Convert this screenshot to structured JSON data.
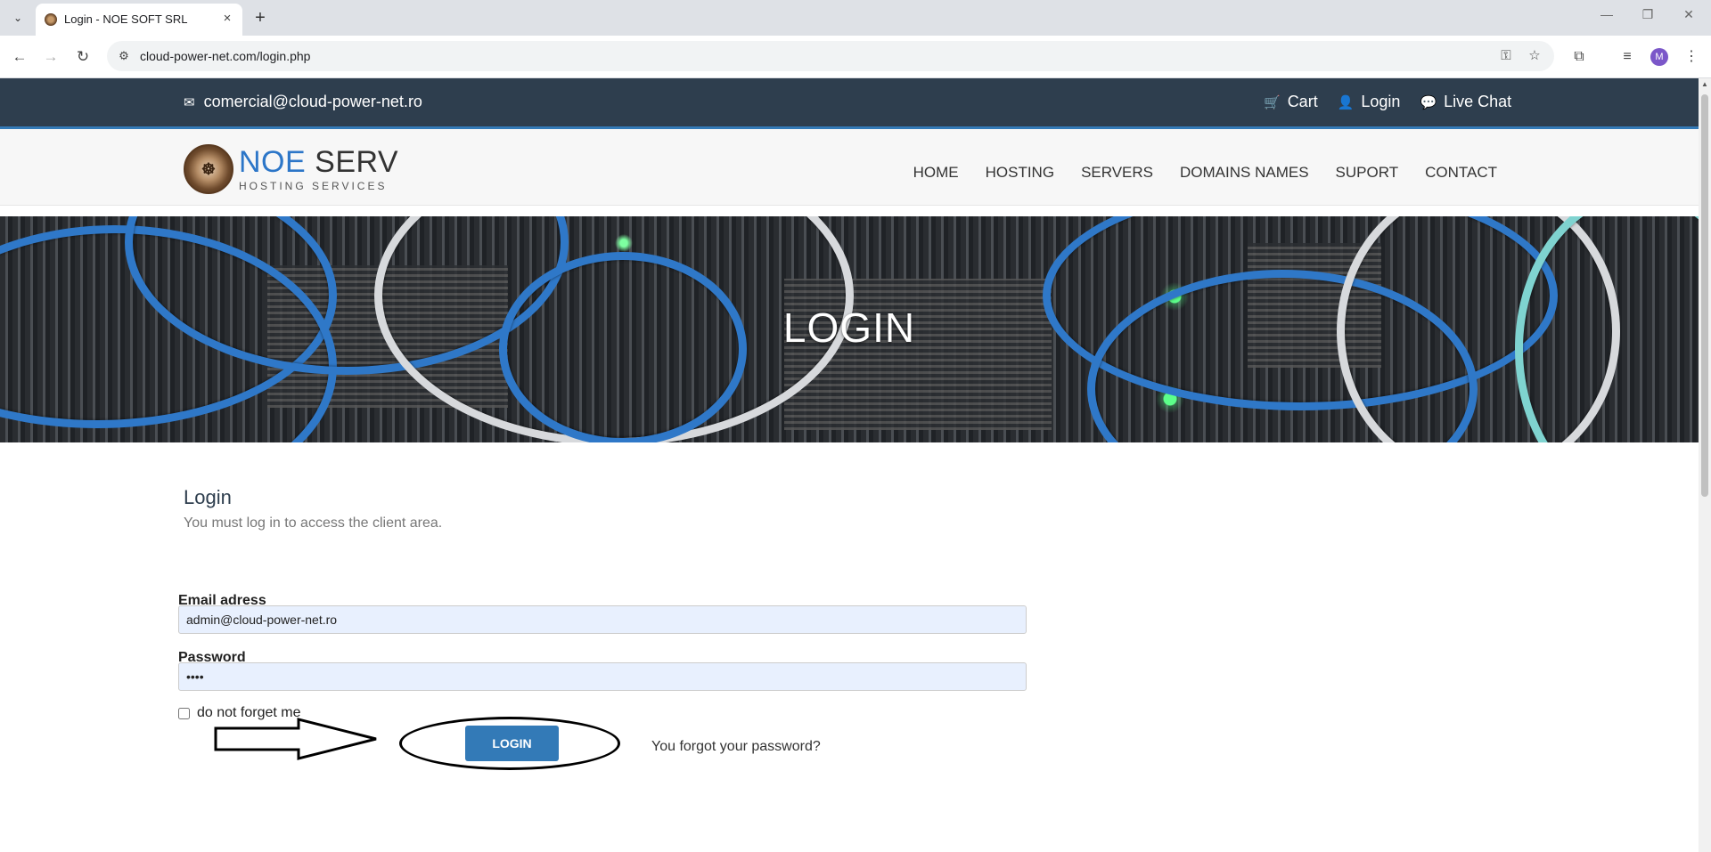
{
  "browser": {
    "tab_title": "Login - NOE SOFT SRL",
    "url": "cloud-power-net.com/login.php",
    "profile_initial": "M"
  },
  "topbar": {
    "email": "comercial@cloud-power-net.ro",
    "cart": "Cart",
    "login": "Login",
    "live_chat": "Live Chat"
  },
  "logo": {
    "noe": "NOE",
    "serv": "SERV",
    "subtitle": "HOSTING SERVICES"
  },
  "nav": {
    "items": [
      "HOME",
      "HOSTING",
      "SERVERS",
      "DOMAINS NAMES",
      "SUPORT",
      "CONTACT"
    ]
  },
  "hero": {
    "title": "LOGIN"
  },
  "login_section": {
    "title": "Login",
    "subtitle": "You must log in to access the client area."
  },
  "form": {
    "email_label": "Email adress",
    "email_value": "admin@cloud-power-net.ro",
    "password_label": "Password",
    "password_value": "••••",
    "remember_label": "do not forget me",
    "remember_checked": false,
    "login_button": "LOGIN",
    "forgot_link": "You forgot your password?"
  },
  "colors": {
    "topbar_bg": "#2e3e4e",
    "accent": "#337ab7",
    "logo_blue": "#2c76c8",
    "input_bg": "#e8f0fe"
  },
  "icons": {
    "email": "envelope-icon",
    "cart": "cart-icon",
    "login": "user-icon",
    "chat": "chat-bubble-icon"
  }
}
